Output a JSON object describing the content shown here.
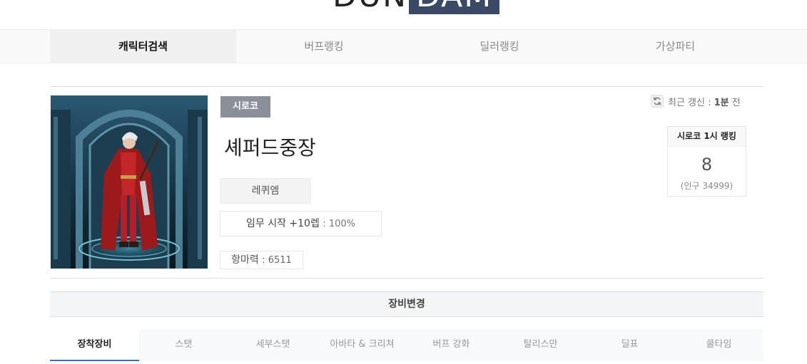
{
  "logo": {
    "part1": "DUN",
    "part2": "DAM"
  },
  "nav": {
    "items": [
      {
        "label": "캐릭터검색",
        "active": true
      },
      {
        "label": "버프랭킹",
        "active": false
      },
      {
        "label": "딜러랭킹",
        "active": false
      },
      {
        "label": "가상파티",
        "active": false
      }
    ]
  },
  "profile": {
    "server": "시로코",
    "name": "셰퍼드중장",
    "job": "레퀴엠",
    "quest_label": "임무 시작",
    "quest_level": "+10렙",
    "quest_percent": ": 100%",
    "power_label": "항마력",
    "power_value": ": 6511"
  },
  "update": {
    "prefix": "최근 갱신 :",
    "value": "1분",
    "suffix": "전",
    "icon": "refresh-icon"
  },
  "ranking": {
    "title": "시로코 1시 랭킹",
    "value": "8",
    "sub": "(인구 34999)"
  },
  "equip_change": {
    "label": "장비변경"
  },
  "subtabs": [
    {
      "label": "장착장비",
      "active": true
    },
    {
      "label": "스탯",
      "active": false
    },
    {
      "label": "세부스탯",
      "active": false
    },
    {
      "label": "아바타 & 크리쳐",
      "active": false
    },
    {
      "label": "버프 강화",
      "active": false
    },
    {
      "label": "탈리스만",
      "active": false
    },
    {
      "label": "딜표",
      "active": false
    },
    {
      "label": "쿨타임",
      "active": false
    }
  ],
  "colors": {
    "accent": "#3e6fb5",
    "logo_bg": "#3a4a66",
    "badge_bg": "#8a8f99"
  }
}
